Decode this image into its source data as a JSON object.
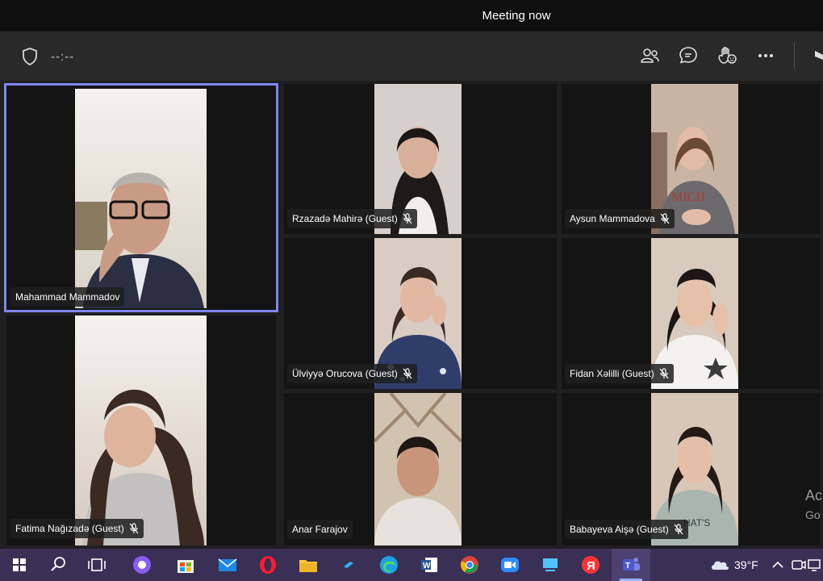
{
  "window": {
    "title": "Meeting now"
  },
  "toolbar": {
    "timer": "--:--",
    "icons": [
      "people-icon",
      "chat-icon",
      "raise-hand-icon",
      "more-icon"
    ]
  },
  "participants": [
    {
      "name": "Mahammad Mammadov",
      "muted": false,
      "active": true
    },
    {
      "name": "Rzazadə Mahirə (Guest)",
      "muted": true
    },
    {
      "name": "Aysun Mammadova",
      "muted": true
    },
    {
      "name": "Ülviyyə Orucova (Guest)",
      "muted": true
    },
    {
      "name": "Fidan Xəlilli (Guest)",
      "muted": true
    },
    {
      "name": "Fatima Nağızadə (Guest)",
      "muted": true
    },
    {
      "name": "Anar Farajov",
      "muted": false
    },
    {
      "name": "Babayeva Aişə (Guest)",
      "muted": true
    }
  ],
  "watermark": {
    "line1": "Ac",
    "line2": "Go"
  },
  "taskbar": {
    "apps": [
      "windows-start",
      "search",
      "task-view",
      "alice",
      "store",
      "mail",
      "opera",
      "file-explorer",
      "app",
      "edge",
      "word",
      "chrome",
      "zoom",
      "connect",
      "yandex",
      "teams"
    ],
    "weather": {
      "temp": "39°F"
    },
    "accent": "#7f85f5"
  }
}
